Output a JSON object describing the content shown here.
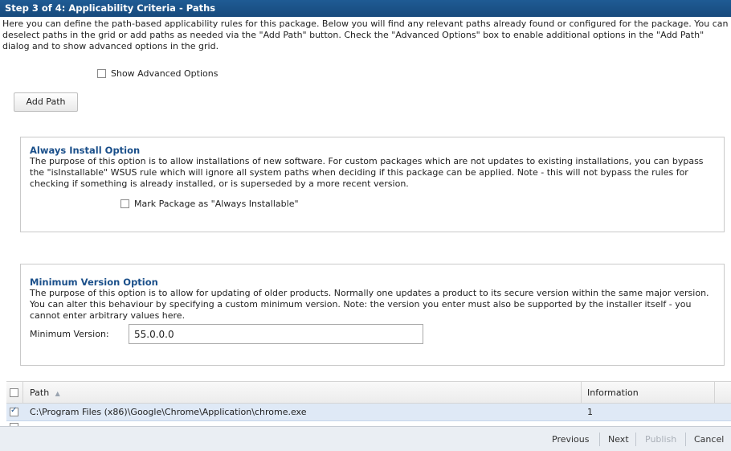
{
  "header": {
    "title": "Step 3 of 4: Applicability Criteria - Paths"
  },
  "intro": {
    "text": "Here you can define the path-based applicability rules for this package. Below you will find any relevant paths already found or configured for the package. You can deselect paths in the grid or add paths as needed via the \"Add Path\" button. Check the \"Advanced Options\" box to enable additional options in the \"Add Path\" dialog and to show advanced options in the grid."
  },
  "advanced_options": {
    "label": "Show Advanced Options",
    "checked": false
  },
  "add_path_button": {
    "label": "Add Path"
  },
  "always_install": {
    "title": "Always Install Option",
    "description": "The purpose of this option is to allow installations of new software. For custom packages which are not updates to existing installations, you can bypass the \"isInstallable\" WSUS rule which will ignore all system paths when deciding if this package can be applied. Note - this will not bypass the rules for checking if something is already installed, or is superseded by a more recent version.",
    "checkbox_label": "Mark Package as \"Always Installable\"",
    "checked": false
  },
  "minimum_version": {
    "title": "Minimum Version Option",
    "description": "The purpose of this option is to allow for updating of older products. Normally one updates a product to its secure version within the same major version. You can alter this behaviour by specifying a custom minimum version. Note: the version you enter must also be supported by the installer itself - you cannot enter arbitrary values here.",
    "field_label": "Minimum Version:",
    "value": "55.0.0.0"
  },
  "grid": {
    "columns": {
      "path": "Path",
      "sort_indicator": "▲",
      "information": "Information"
    },
    "rows": [
      {
        "checked": true,
        "path": "C:\\Program Files (x86)\\Google\\Chrome\\Application\\chrome.exe",
        "information": "1"
      }
    ]
  },
  "footer": {
    "previous": "Previous",
    "next": "Next",
    "publish": "Publish",
    "cancel": "Cancel"
  },
  "colors": {
    "title_bar": "#1a5289",
    "panel_title": "#1a4f8a",
    "selected_row": "#dfe9f6"
  }
}
